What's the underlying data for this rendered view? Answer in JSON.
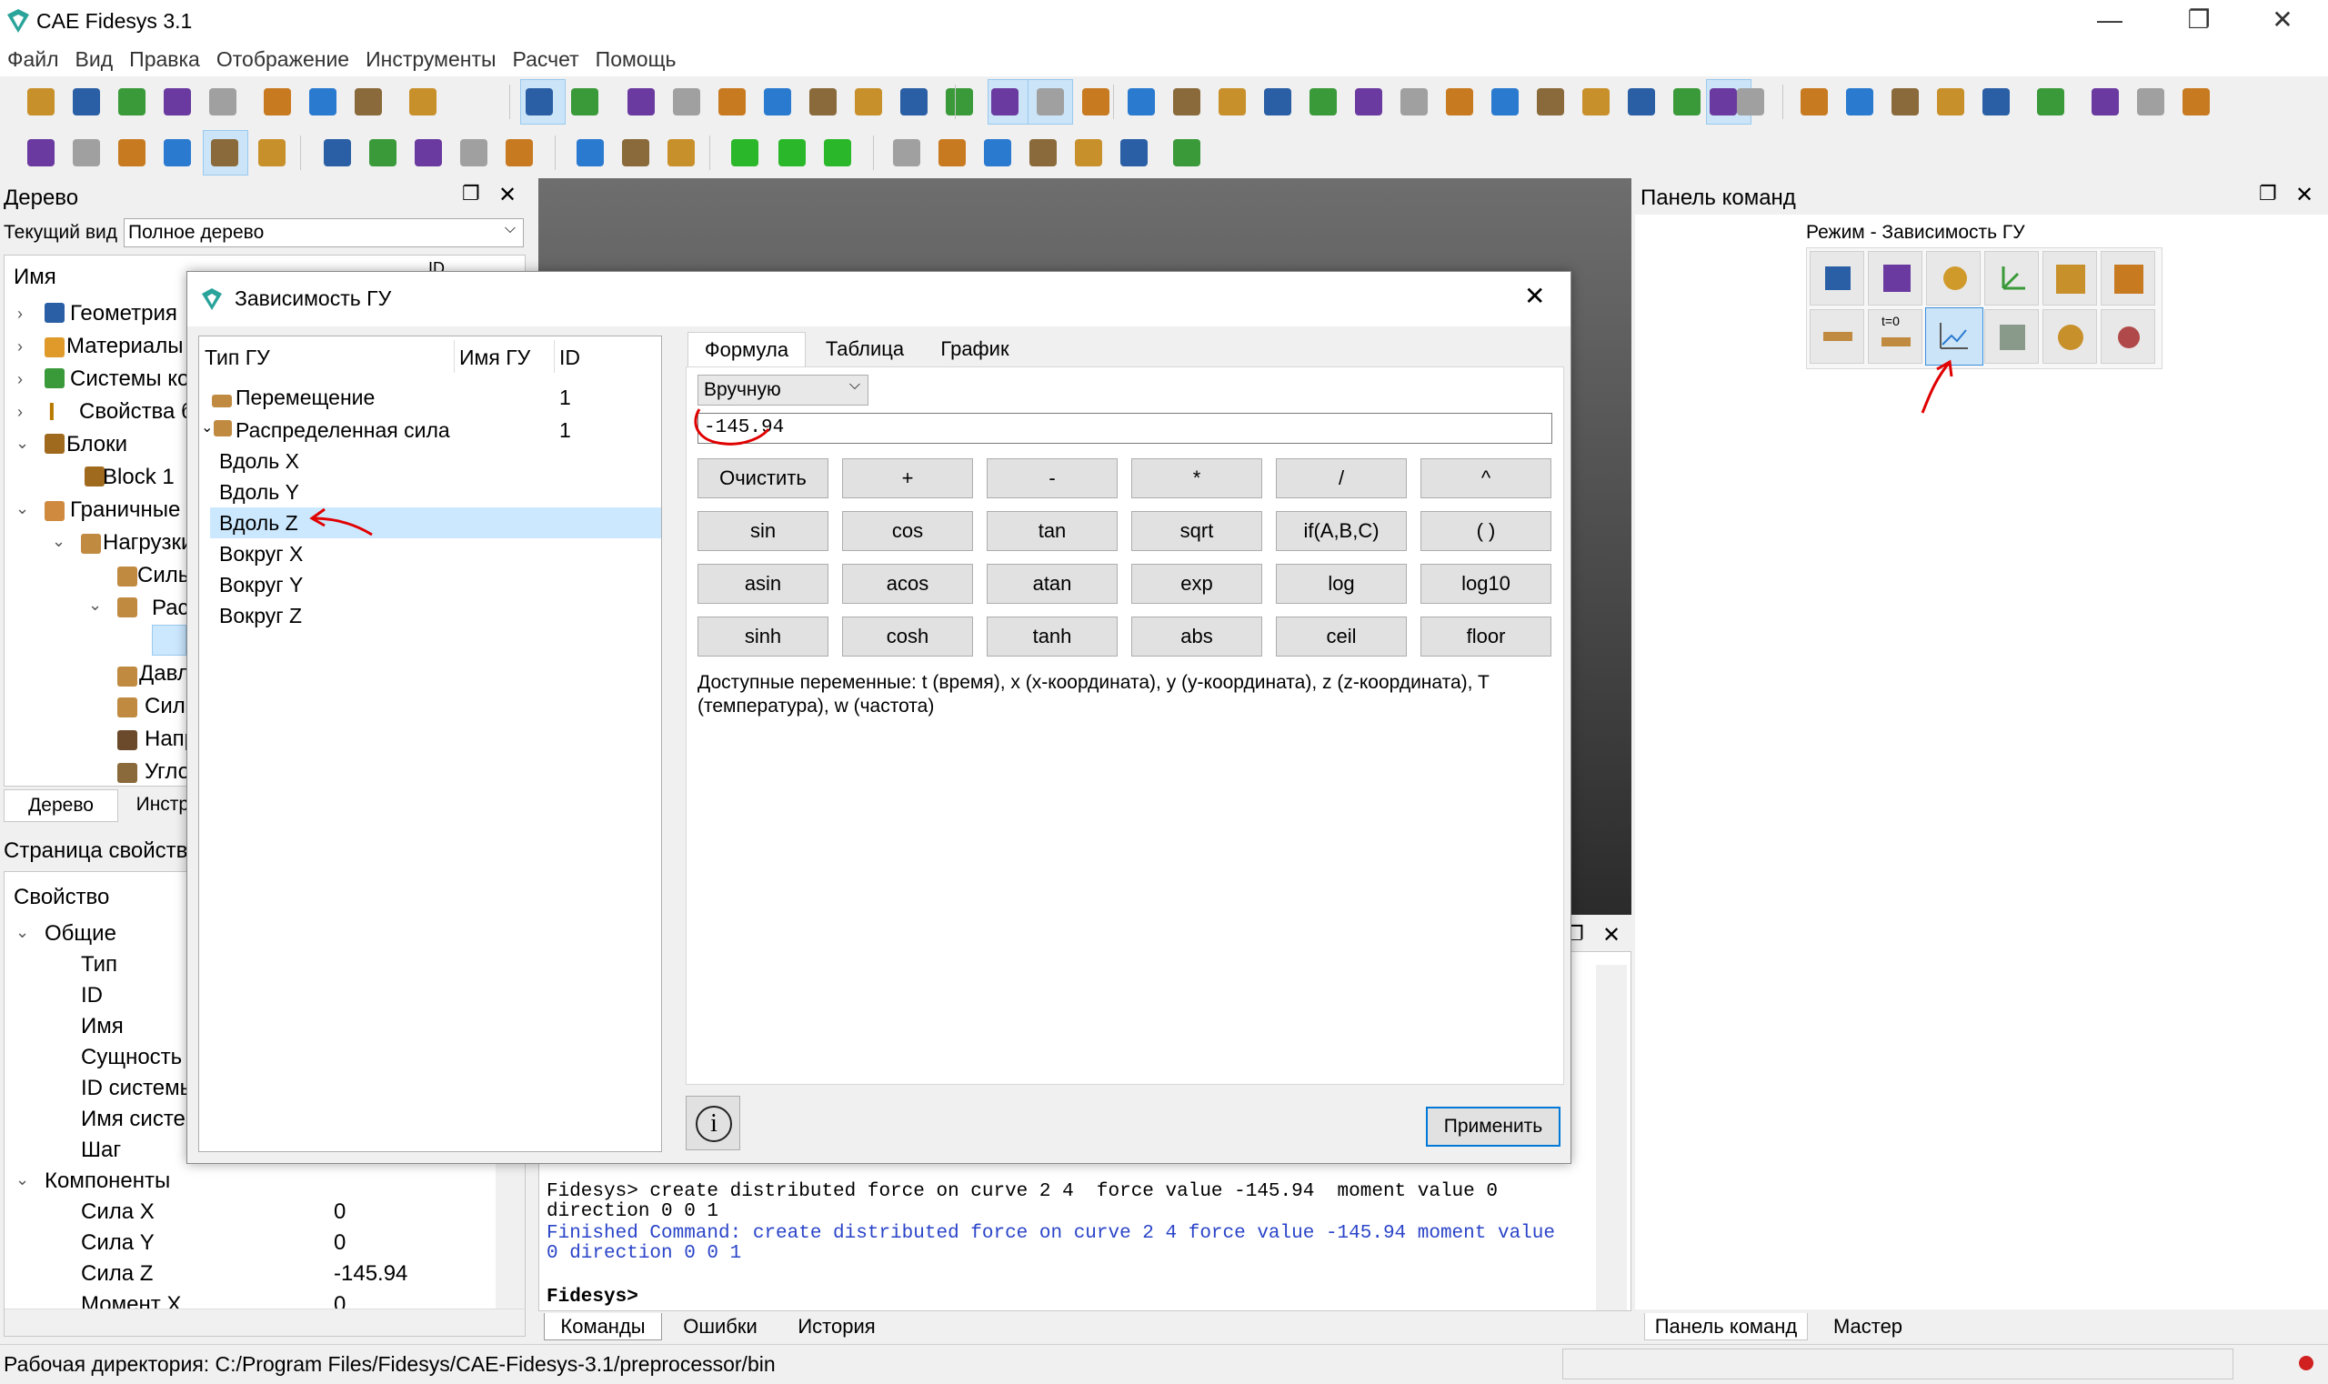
{
  "window": {
    "title": "CAE Fidesys 3.1",
    "minimize": "—",
    "maximize": "❐",
    "close": "✕"
  },
  "menu": [
    "Файл",
    "Вид",
    "Правка",
    "Отображение",
    "Инструменты",
    "Расчет",
    "Помощь"
  ],
  "tree_panel": {
    "title": "Дерево",
    "view_label": "Текущий вид",
    "view_value": "Полное дерево",
    "col_name": "Имя",
    "col_id": "ID",
    "items": [
      {
        "label": "Геометрия"
      },
      {
        "label": "Материалы"
      },
      {
        "label": "Системы ко"
      },
      {
        "label": "Свойства б"
      },
      {
        "label": "Блоки"
      },
      {
        "label": "Block 1"
      },
      {
        "label": "Граничные"
      },
      {
        "label": "Нагрузки"
      },
      {
        "label": "Силы"
      },
      {
        "label": "Рас"
      },
      {
        "label": "Давл"
      },
      {
        "label": "Силы"
      },
      {
        "label": "Напр"
      },
      {
        "label": "Угло"
      }
    ],
    "tabs": [
      "Дерево",
      "Инстру"
    ]
  },
  "props_panel": {
    "title": "Страница свойств",
    "col_property": "Свойство",
    "groups": [
      {
        "label": "Общие",
        "rows": [
          {
            "name": "Тип",
            "value": ""
          },
          {
            "name": "ID",
            "value": ""
          },
          {
            "name": "Имя",
            "value": ""
          },
          {
            "name": "Сущность",
            "value": ""
          },
          {
            "name": "ID системы",
            "value": ""
          },
          {
            "name": "Имя систем",
            "value": ""
          },
          {
            "name": "Шаг",
            "value": ""
          }
        ]
      },
      {
        "label": "Компоненты",
        "rows": [
          {
            "name": "Сила X",
            "value": "0"
          },
          {
            "name": "Сила Y",
            "value": "0"
          },
          {
            "name": "Сила Z",
            "value": "-145.94"
          },
          {
            "name": "Момент X",
            "value": "0"
          }
        ]
      }
    ]
  },
  "dialog": {
    "title": "Зависимость ГУ",
    "close": "✕",
    "list_headers": [
      "Тип ГУ",
      "Имя ГУ",
      "ID"
    ],
    "bc_types": [
      {
        "label": "Перемещение",
        "id": "1"
      },
      {
        "label": "Распределенная сила",
        "id": "1"
      }
    ],
    "components": [
      "Вдоль X",
      "Вдоль Y",
      "Вдоль Z",
      "Вокруг X",
      "Вокруг Y",
      "Вокруг Z"
    ],
    "selected_component": "Вдоль Z",
    "tabs": [
      "Формула",
      "Таблица",
      "График"
    ],
    "active_tab": "Формула",
    "mode_select": "Вручную",
    "formula": "-145.94",
    "buttons_row1": [
      "Очистить",
      "+",
      "-",
      "*",
      "/",
      "^"
    ],
    "buttons_row2": [
      "sin",
      "cos",
      "tan",
      "sqrt",
      "if(A,B,C)",
      "(  )"
    ],
    "buttons_row3": [
      "asin",
      "acos",
      "atan",
      "exp",
      "log",
      "log10"
    ],
    "buttons_row4": [
      "sinh",
      "cosh",
      "tanh",
      "abs",
      "ceil",
      "floor"
    ],
    "variables_text": "Доступные переменные: t (время), x (x-координата), y (y-координата), z (z-координата), T (температура), w (частота)",
    "info": "i",
    "apply": "Применить"
  },
  "console": {
    "line1": "Fidesys> create distributed force on curve 2 4  force value -145.94  moment value 0",
    "line2": "direction 0 0 1",
    "line3": "Finished Command: create distributed force on curve 2 4 force value -145.94 moment value",
    "line4": "0 direction 0 0 1",
    "prompt": "Fidesys>",
    "tabs": [
      "Команды",
      "Ошибки",
      "История"
    ]
  },
  "command_panel": {
    "title": "Панель команд",
    "mode": "Режим - Зависимость ГУ",
    "tabs": [
      "Панель команд",
      "Мастер"
    ],
    "t0_label": "t=0"
  },
  "status": {
    "text": "Рабочая директория: C:/Program Files/Fidesys/CAE-Fidesys-3.1/preprocessor/bin"
  },
  "colors": {
    "selection": "#cce8ff",
    "accent": "#0078d7",
    "annotation": "#e00000",
    "viewport_top": "#6e6e6e",
    "viewport_bottom": "#2b2b2b"
  }
}
